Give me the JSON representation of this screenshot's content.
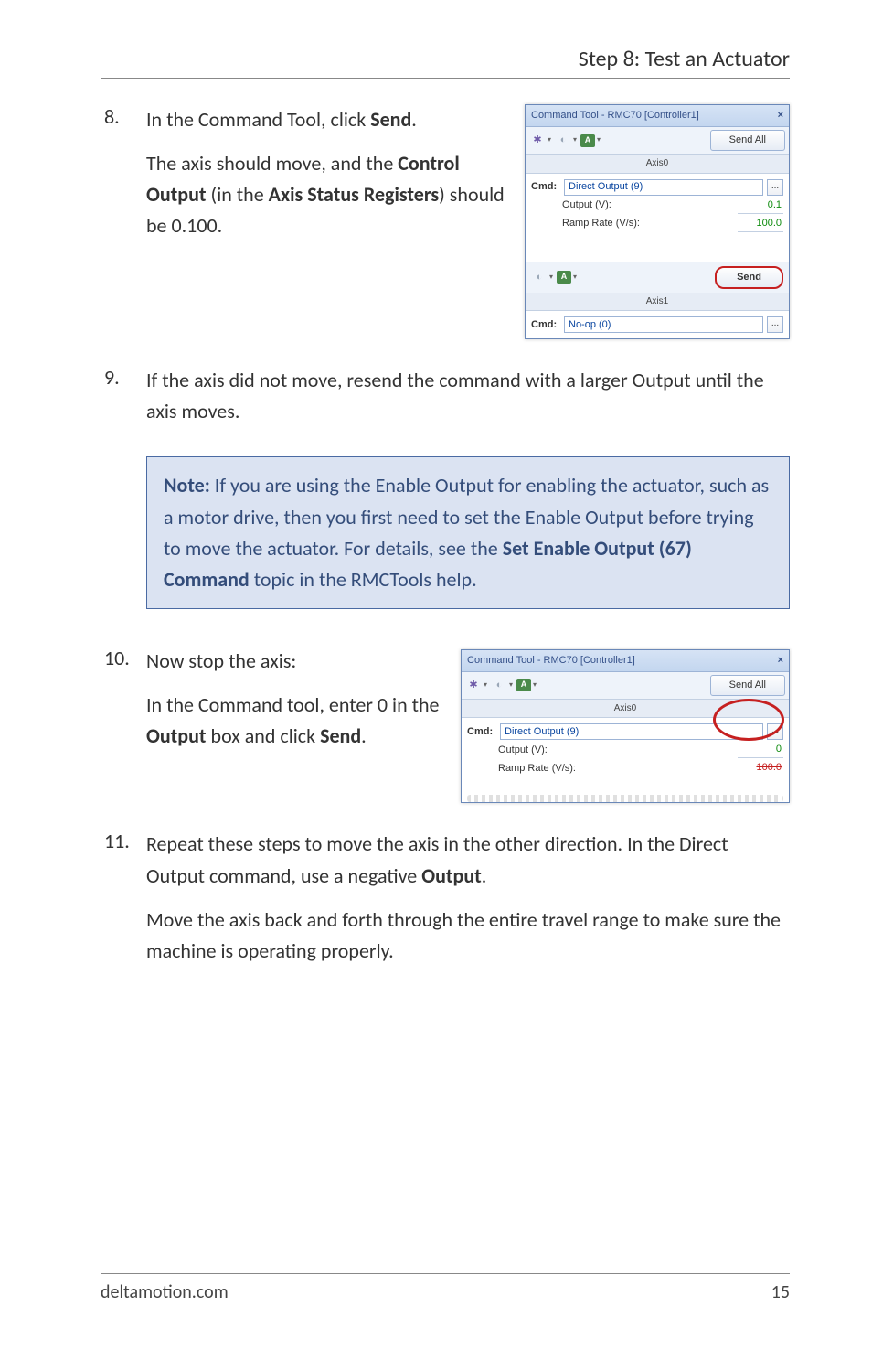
{
  "header": {
    "title": "Step 8: Test an Actuator"
  },
  "steps": {
    "s8": {
      "num": "8.",
      "para1a": "In the Command Tool, click ",
      "para1b": "Send",
      "para1c": ".",
      "para2a": "The axis should move, and the ",
      "para2b": "Control Output",
      "para2c": " (in the ",
      "para2d": "Axis Status Registers",
      "para2e": ") should be 0.100."
    },
    "s9": {
      "num": "9.",
      "text": "If the axis did not move, resend the command with a larger Output until the axis moves."
    },
    "note": {
      "a": "Note:",
      "b": " If you are using the Enable Output for enabling the actuator, such as a motor drive, then you first need to set the Enable Output before trying to move the actuator. For details, see the ",
      "c": "Set Enable Output (67) Command",
      "d": " topic in the RMCTools help."
    },
    "s10": {
      "num": "10.",
      "line1": "Now stop the axis:",
      "line2a": "In the Command tool, enter 0 in the ",
      "line2b": "Output",
      "line2c": " box and click ",
      "line2d": "Send",
      "line2e": "."
    },
    "s11": {
      "num": "11.",
      "a": "Repeat these steps to move the axis in the other direction. In the Direct Output command, use a negative ",
      "b": "Output",
      "c": ".",
      "d": "Move the axis back and forth through the entire travel range to make sure the machine is operating properly."
    }
  },
  "cmd1": {
    "title": "Command Tool - RMC70 [Controller1]",
    "sendAll": "Send All",
    "axis0": "Axis0",
    "cmdLbl": "Cmd:",
    "cmdVal": "Direct Output (9)",
    "outLbl": "Output (V):",
    "outVal": "0.1",
    "rampLbl": "Ramp Rate (V/s):",
    "rampVal": "100.0",
    "send": "Send",
    "axis1": "Axis1",
    "cmd2Val": "No-op (0)"
  },
  "cmd2": {
    "title": "Command Tool - RMC70 [Controller1]",
    "sendAll": "Send All",
    "axis0": "Axis0",
    "cmdLbl": "Cmd:",
    "cmdVal": "Direct Output (9)",
    "outLbl": "Output (V):",
    "outVal": "0",
    "rampLbl": "Ramp Rate (V/s):",
    "rampVal": "100.0"
  },
  "footer": {
    "left": "deltamotion.com",
    "right": "15"
  }
}
